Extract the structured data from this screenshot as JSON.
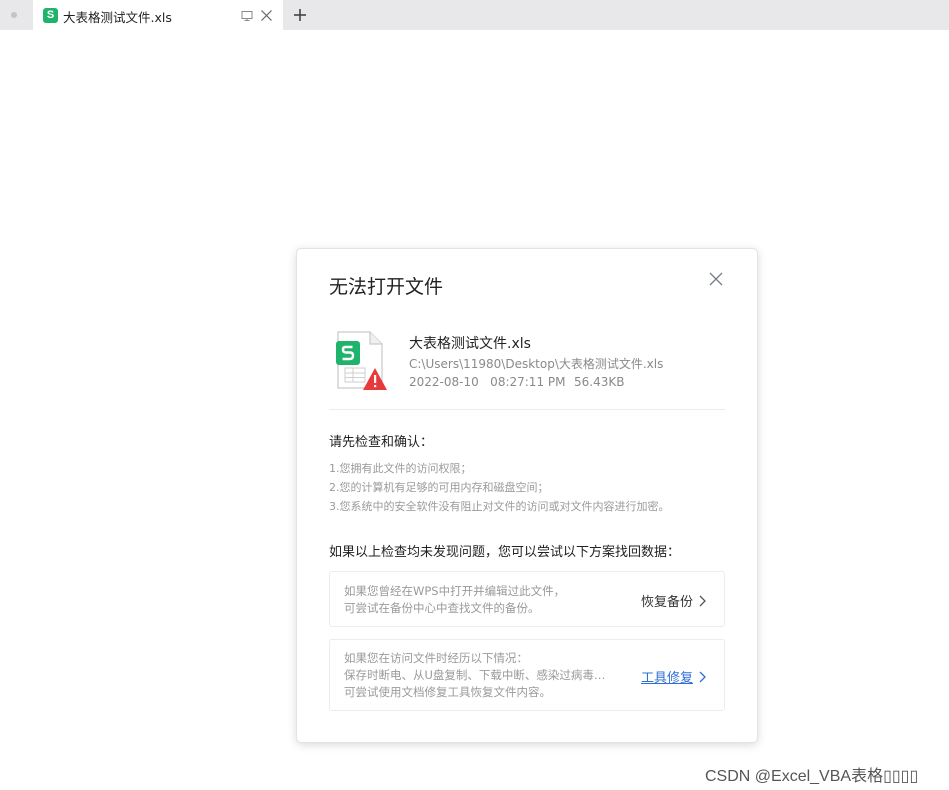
{
  "tab": {
    "icon_letter": "S",
    "title": "大表格测试文件.xls"
  },
  "dialog": {
    "title": "无法打开文件",
    "file": {
      "name": "大表格测试文件.xls",
      "path": "C:\\Users\\11980\\Desktop\\大表格测试文件.xls",
      "datetime": "2022-08-10   08:27:11 PM",
      "size": "56.43KB"
    },
    "check_heading": "请先检查和确认：",
    "check_items": [
      "1.您拥有此文件的访问权限；",
      "2.您的计算机有足够的可用内存和磁盘空间；",
      "3.您系统中的安全软件没有阻止对文件的访问或对文件内容进行加密。"
    ],
    "try_heading": "如果以上检查均未发现问题，您可以尝试以下方案找回数据：",
    "option_backup": {
      "lines": [
        "如果您曾经在WPS中打开并编辑过此文件，",
        "可尝试在备份中心中查找文件的备份。"
      ],
      "action": "恢复备份"
    },
    "option_repair": {
      "lines": [
        "如果您在访问文件时经历以下情况：",
        "保存时断电、从U盘复制、下载中断、感染过病毒…",
        "可尝试使用文档修复工具恢复文件内容。"
      ],
      "action": "工具修复"
    }
  },
  "watermark": "CSDN @Excel_VBA表格▯▯▯▯",
  "colors": {
    "accent": "#2e6fd6",
    "brand_green": "#1fb36b",
    "warning_red": "#e83a3a"
  }
}
